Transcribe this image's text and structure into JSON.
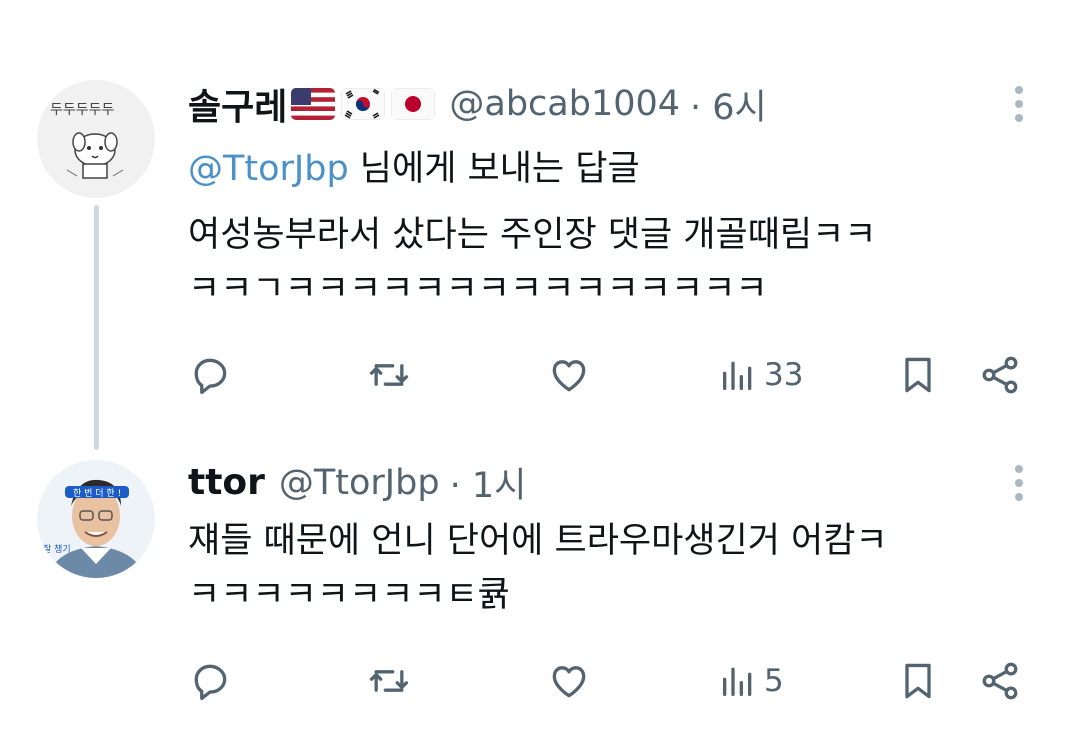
{
  "tweets": [
    {
      "name": "솔구레",
      "flags": [
        "us-flag-icon",
        "kr-flag-icon",
        "jp-flag-icon"
      ],
      "handle": "@abcab1004",
      "time": "· 6시",
      "reply_to_mention": "@TtorJbp",
      "reply_to_suffix": " 님에게 보내는 답글",
      "text_line1": "여성농부라서 샀다는 주인장 댓글 개골때림ㅋㅋ",
      "text_line2": "ㅋㅋㄱㅋㅋㅋㅋㅋㅋㅋㅋㅋㅋㅋㅋㅋㅋㅋ",
      "views": "33"
    },
    {
      "name": "ttor",
      "handle": "@TtorJbp",
      "time": "· 1시",
      "text_line1": "쟤들 때문에 언니 단어에 트라우마생긴거 어캄ㅋ",
      "text_line2": "ㅋㅋㅋㅋㅋㅋㅋㅋㅌ큙",
      "views": "5"
    }
  ],
  "colors": {
    "text": "#0f1419",
    "secondary": "#536471",
    "mention": "#4a90c9",
    "thread": "#cfd9de"
  }
}
